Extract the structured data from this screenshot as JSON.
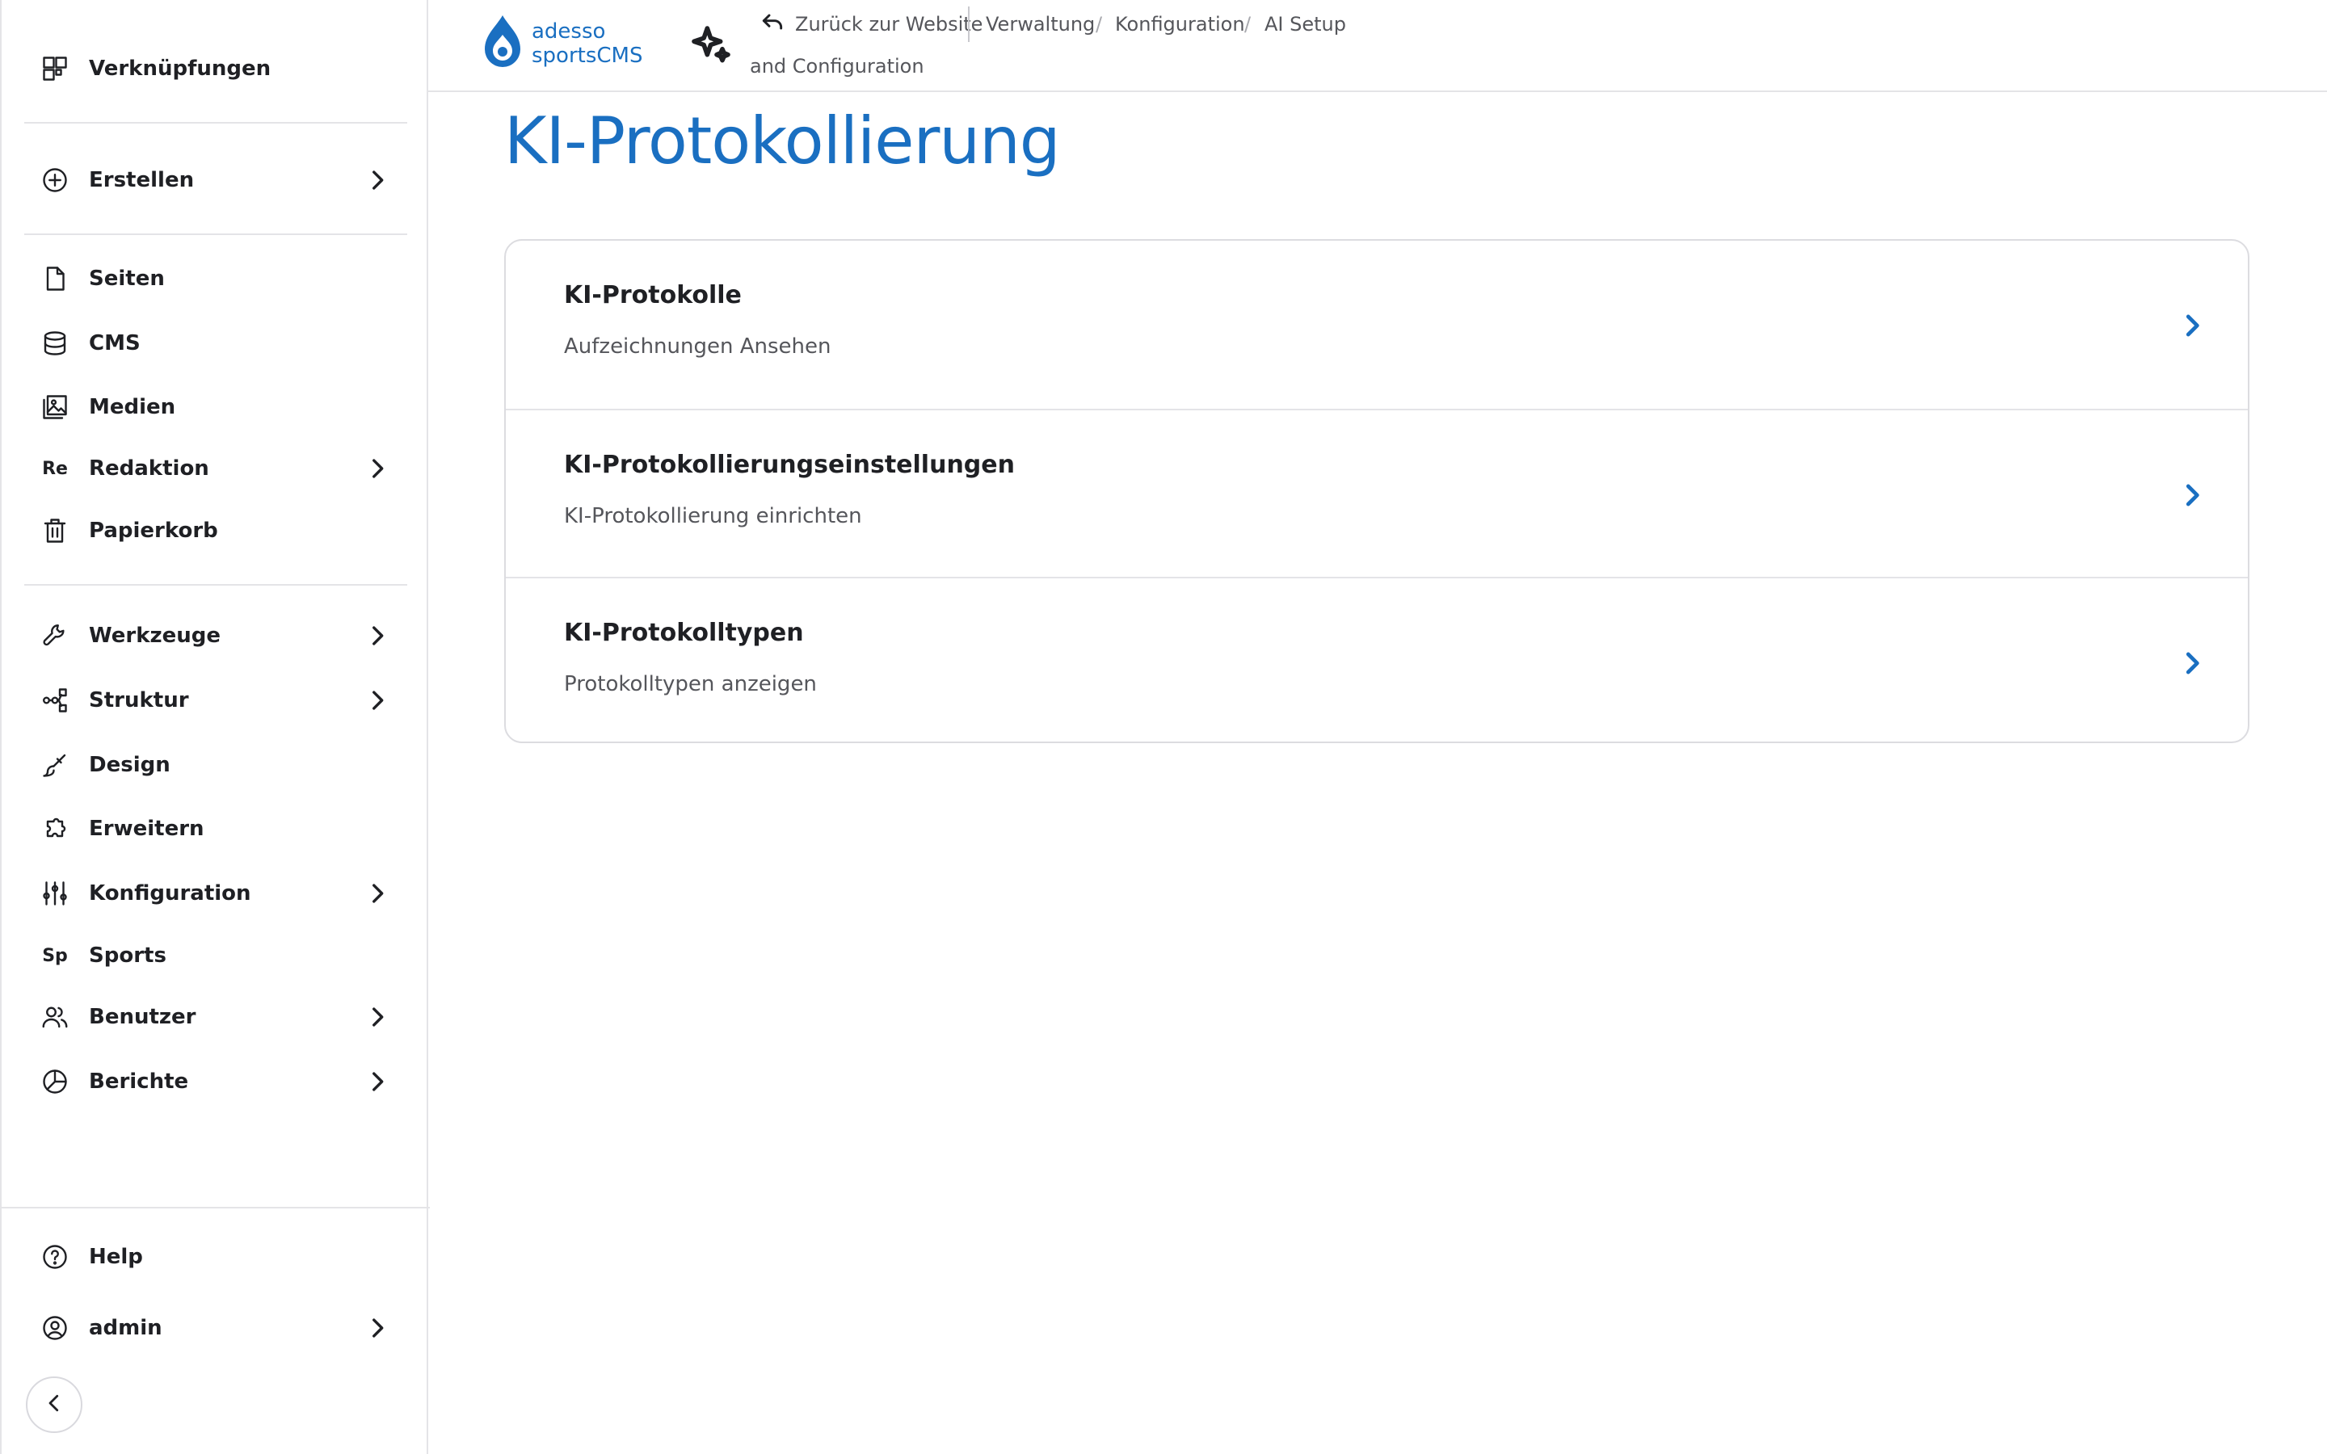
{
  "header": {
    "logo": {
      "line1": "adesso",
      "line2": "sportsCMS"
    },
    "back_label": "Zurück zur Website",
    "breadcrumb": [
      "Verwaltung",
      "Konfiguration",
      "AI Setup",
      "and Configuration"
    ],
    "breadcrumb_separator": "/"
  },
  "sidebar": {
    "shortcuts": "Verknüpfungen",
    "create": "Erstellen",
    "items": [
      {
        "label": "Seiten",
        "icon": "page-icon"
      },
      {
        "label": "CMS",
        "icon": "database-icon"
      },
      {
        "label": "Medien",
        "icon": "media-icon"
      },
      {
        "label": "Redaktion",
        "abbr": "Re",
        "has_children": true
      },
      {
        "label": "Papierkorb",
        "icon": "trash-icon"
      }
    ],
    "admin_items": [
      {
        "label": "Werkzeuge",
        "icon": "wrench-icon",
        "has_children": true
      },
      {
        "label": "Struktur",
        "icon": "structure-icon",
        "has_children": true
      },
      {
        "label": "Design",
        "icon": "brush-icon"
      },
      {
        "label": "Erweitern",
        "icon": "puzzle-icon"
      },
      {
        "label": "Konfiguration",
        "icon": "sliders-icon",
        "has_children": true
      },
      {
        "label": "Sports",
        "abbr": "Sp"
      },
      {
        "label": "Benutzer",
        "icon": "users-icon",
        "has_children": true
      },
      {
        "label": "Berichte",
        "icon": "chart-pie-icon",
        "has_children": true
      }
    ],
    "help": "Help",
    "user": "admin"
  },
  "main": {
    "title": "KI-Protokollierung",
    "items": [
      {
        "title": "KI-Protokolle",
        "description": "Aufzeichnungen Ansehen"
      },
      {
        "title": "KI-Protokollierungseinstellungen",
        "description": "KI-Protokollierung einrichten"
      },
      {
        "title": "KI-Protokolltypen",
        "description": "Protokolltypen anzeigen"
      }
    ]
  },
  "colors": {
    "accent": "#1a6fc1",
    "text": "#1f2024",
    "muted": "#55565b",
    "border": "#e4e4e7"
  }
}
